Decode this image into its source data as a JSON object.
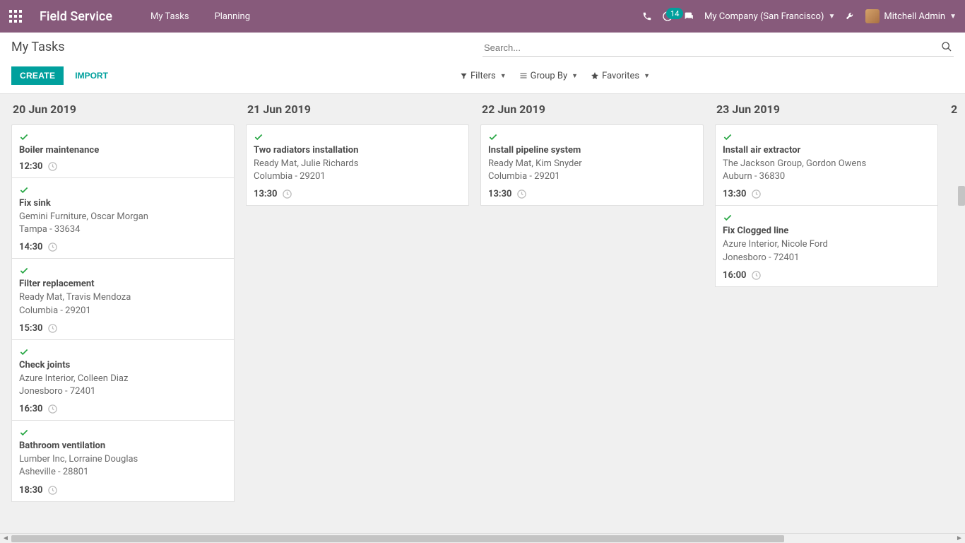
{
  "navbar": {
    "app_name": "Field Service",
    "menu": [
      {
        "label": "My Tasks"
      },
      {
        "label": "Planning"
      }
    ],
    "notif_count": "14",
    "company": "My Company (San Francisco)",
    "user_name": "Mitchell Admin"
  },
  "control_panel": {
    "breadcrumb": "My Tasks",
    "search_placeholder": "Search...",
    "create_label": "CREATE",
    "import_label": "IMPORT",
    "filters_label": "Filters",
    "groupby_label": "Group By",
    "favorites_label": "Favorites"
  },
  "columns": [
    {
      "title": "20 Jun 2019",
      "cards": [
        {
          "title": "Boiler maintenance",
          "lines": [],
          "time": "12:30"
        },
        {
          "title": "Fix sink",
          "lines": [
            "Gemini Furniture, Oscar Morgan",
            "Tampa - 33634"
          ],
          "time": "14:30"
        },
        {
          "title": "Filter replacement",
          "lines": [
            "Ready Mat, Travis Mendoza",
            "Columbia - 29201"
          ],
          "time": "15:30"
        },
        {
          "title": "Check joints",
          "lines": [
            "Azure Interior, Colleen Diaz",
            "Jonesboro - 72401"
          ],
          "time": "16:30"
        },
        {
          "title": "Bathroom ventilation",
          "lines": [
            "Lumber Inc, Lorraine Douglas",
            "Asheville - 28801"
          ],
          "time": "18:30"
        }
      ]
    },
    {
      "title": "21 Jun 2019",
      "cards": [
        {
          "title": "Two radiators installation",
          "lines": [
            "Ready Mat, Julie Richards",
            "Columbia - 29201"
          ],
          "time": "13:30"
        }
      ]
    },
    {
      "title": "22 Jun 2019",
      "cards": [
        {
          "title": "Install pipeline system",
          "lines": [
            "Ready Mat, Kim Snyder",
            "Columbia - 29201"
          ],
          "time": "13:30"
        }
      ]
    },
    {
      "title": "23 Jun 2019",
      "cards": [
        {
          "title": "Install air extractor",
          "lines": [
            "The Jackson Group, Gordon Owens",
            "Auburn - 36830"
          ],
          "time": "13:30"
        },
        {
          "title": "Fix Clogged line",
          "lines": [
            "Azure Interior, Nicole Ford",
            "Jonesboro - 72401"
          ],
          "time": "16:00"
        }
      ]
    },
    {
      "title": "2",
      "cards": []
    }
  ]
}
